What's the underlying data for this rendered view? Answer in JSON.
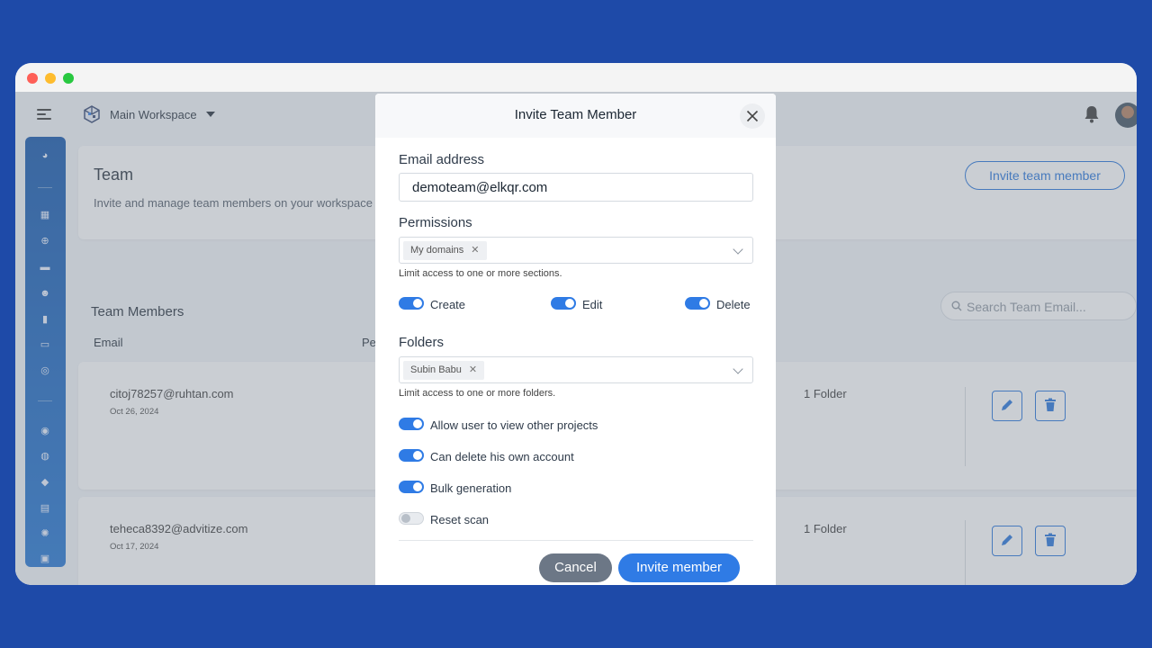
{
  "topbar": {
    "workspace_name": "Main Workspace"
  },
  "team": {
    "title": "Team",
    "subtitle": "Invite and manage team members on your workspace",
    "invite_button": "Invite team member"
  },
  "members": {
    "title": "Team Members",
    "search_placeholder": "Search Team Email...",
    "columns": {
      "email": "Email",
      "permissions": "Pe"
    },
    "rows": [
      {
        "email": "citoj78257@ruhtan.com",
        "date": "Oct 26, 2024",
        "folders": "1 Folder"
      },
      {
        "email": "teheca8392@advitize.com",
        "date": "Oct 17, 2024",
        "folders": "1 Folder"
      }
    ]
  },
  "modal": {
    "title": "Invite Team Member",
    "email_label": "Email address",
    "email_value": "demoteam@elkqr.com",
    "permissions_label": "Permissions",
    "permissions_chip": "My domains",
    "permissions_help": "Limit access to one or more sections.",
    "perm_toggles": [
      {
        "label": "Create",
        "on": true
      },
      {
        "label": "Edit",
        "on": true
      },
      {
        "label": "Delete",
        "on": true
      }
    ],
    "folders_label": "Folders",
    "folders_chip": "Subin Babu",
    "folders_help": "Limit access to one or more folders.",
    "options": [
      {
        "label": "Allow user to view other projects",
        "on": true
      },
      {
        "label": "Can delete his own account",
        "on": true
      },
      {
        "label": "Bulk generation",
        "on": true
      },
      {
        "label": "Reset scan",
        "on": false
      }
    ],
    "cancel_label": "Cancel",
    "invite_label": "Invite member"
  },
  "colors": {
    "background": "#1e4aa8",
    "accent": "#2f7be5",
    "sidebar": "#0a4fa8"
  }
}
